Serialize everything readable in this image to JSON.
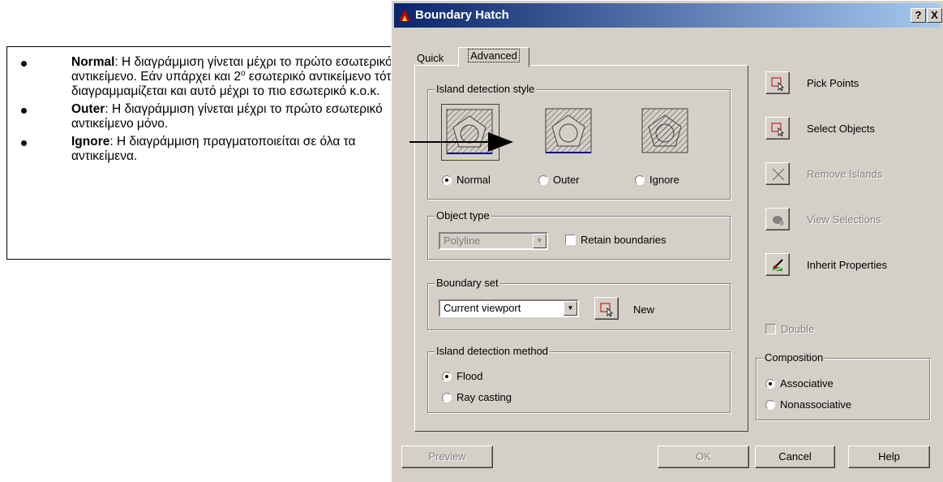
{
  "annotation": {
    "items": [
      {
        "term": "Normal",
        "text": ": Η διαγράμμιση γίνεται μέχρι το πρώτο εσωτερικό αντικείμενο. Εάν υπάρχει και 2",
        "sup": "ο",
        "text2": " εσωτερικό αντικείμενο τότε διαγραμμαμίζεται και αυτό μέχρι το πιο εσωτερικό κ.ο.κ."
      },
      {
        "term": "Outer",
        "text": ": Η διαγράμμιση γίνεται μέχρι το πρώτο εσωτερικό αντικείμενο μόνο."
      },
      {
        "term": "Ignore",
        "text": ": Η διαγράμμιση πραγματοποιείται σε όλα τα αντικείμενα."
      }
    ]
  },
  "dialog": {
    "title": "Boundary Hatch",
    "help_btn": "?",
    "close_btn": "X",
    "tabs": [
      "Quick",
      "Advanced"
    ],
    "island_style": {
      "label": "Island detection style",
      "options": [
        {
          "label": "Normal",
          "selected": true
        },
        {
          "label": "Outer",
          "selected": false
        },
        {
          "label": "Ignore",
          "selected": false
        }
      ]
    },
    "object_type": {
      "label": "Object type",
      "value": "Polyline",
      "retain_label": "Retain boundaries"
    },
    "boundary_set": {
      "label": "Boundary set",
      "value": "Current viewport",
      "new_label": "New"
    },
    "island_method": {
      "label": "Island detection method",
      "options": [
        {
          "label": "Flood",
          "selected": true
        },
        {
          "label": "Ray casting",
          "selected": false
        }
      ]
    },
    "side_buttons": {
      "pick_points": "Pick Points",
      "select_objects": "Select Objects",
      "remove_islands": "Remove Islands",
      "view_selections": "View Selections",
      "inherit_properties": "Inherit Properties"
    },
    "double_label": "Double",
    "composition": {
      "label": "Composition",
      "options": [
        {
          "label": "Associative",
          "selected": true
        },
        {
          "label": "Nonassociative",
          "selected": false
        }
      ]
    },
    "bottom_buttons": {
      "preview": "Preview",
      "ok": "OK",
      "cancel": "Cancel",
      "help": "Help"
    }
  },
  "colors": {
    "titlebar_start": "#0a246a",
    "titlebar_end": "#a6caf0",
    "face": "#d4d0c8",
    "disabled": "#808080"
  }
}
